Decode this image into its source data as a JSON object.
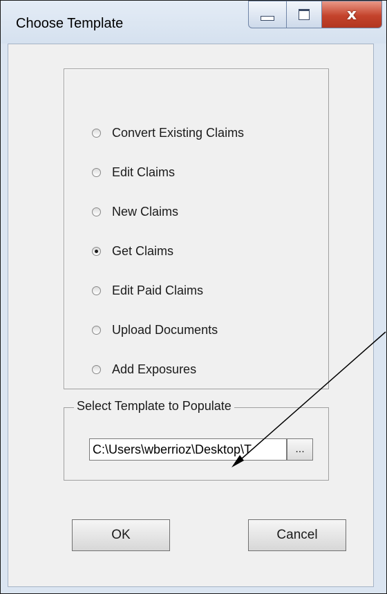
{
  "window": {
    "title": "Choose Template"
  },
  "options": [
    {
      "label": "Convert Existing Claims",
      "checked": false
    },
    {
      "label": "Edit Claims",
      "checked": false
    },
    {
      "label": "New Claims",
      "checked": false
    },
    {
      "label": "Get Claims",
      "checked": true
    },
    {
      "label": "Edit Paid Claims",
      "checked": false
    },
    {
      "label": "Upload Documents",
      "checked": false
    },
    {
      "label": "Add Exposures",
      "checked": false
    }
  ],
  "template_group": {
    "legend": "Select Template to Populate",
    "path_value": "C:\\Users\\wberrioz\\Desktop\\T",
    "browse_label": "..."
  },
  "buttons": {
    "ok": "OK",
    "cancel": "Cancel"
  },
  "icons": {
    "minimize": "minimize-icon",
    "maximize": "maximize-icon",
    "close": "close-icon",
    "close_glyph": "x"
  }
}
